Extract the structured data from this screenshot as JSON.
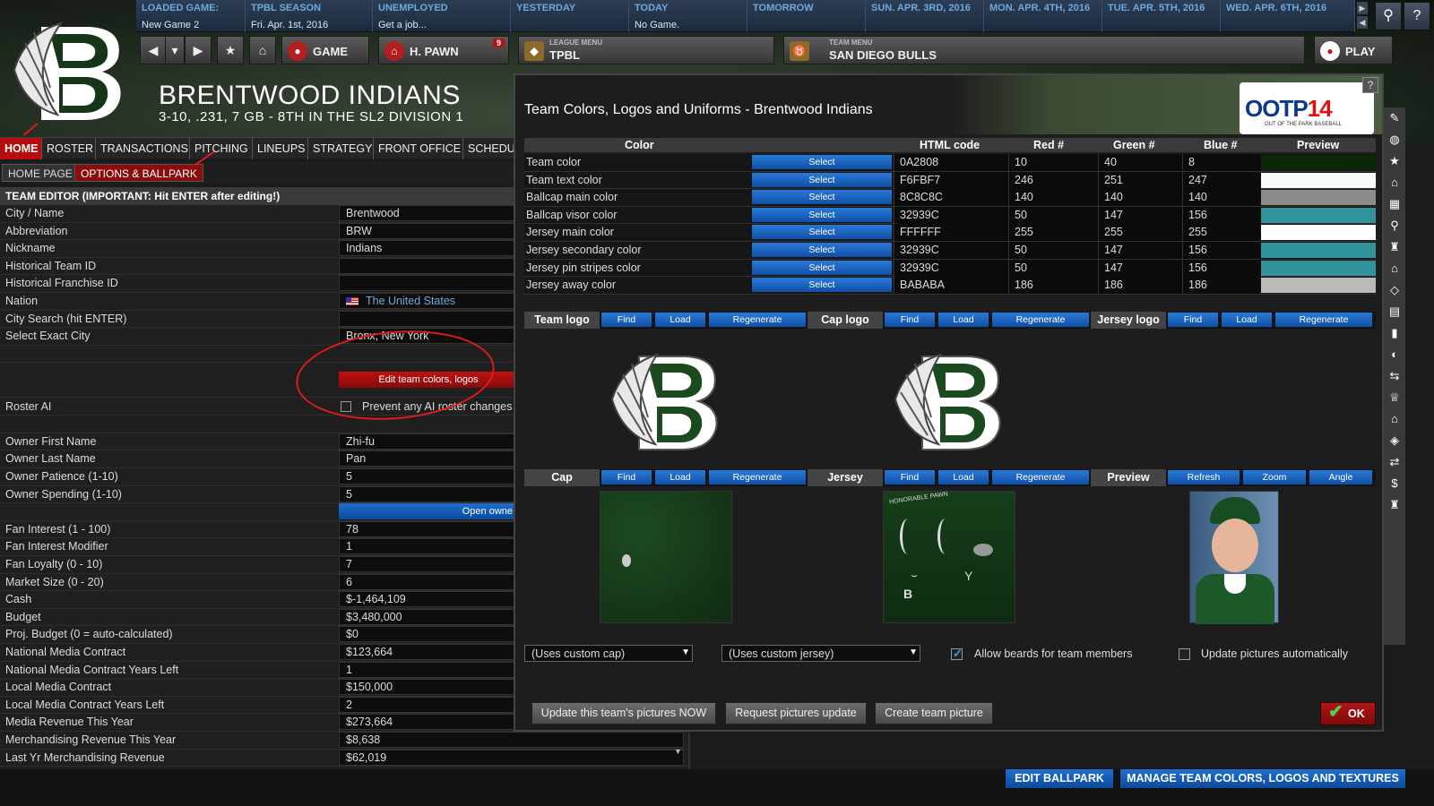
{
  "timeline": {
    "loaded_game_label": "LOADED GAME:",
    "loaded_game_value": "New Game 2",
    "season_label": "TPBL SEASON",
    "season_value": "Fri. Apr. 1st, 2016",
    "job_label": "UNEMPLOYED",
    "job_value": "Get a job...",
    "yesterday_label": "YESTERDAY",
    "today_label": "TODAY",
    "today_value": "No Game.",
    "tomorrow_label": "TOMORROW",
    "days": [
      "SUN. APR. 3RD, 2016",
      "MON. APR. 4TH, 2016",
      "TUE. APR. 5TH, 2016",
      "WED. APR. 6TH, 2016"
    ]
  },
  "nav": {
    "game_label": "GAME",
    "manager_label": "H. PAWN",
    "manager_badge": "9",
    "league_menu_small": "LEAGUE MENU",
    "league_menu_value": "TPBL",
    "team_menu_small": "TEAM MENU",
    "team_menu_value": "SAN DIEGO BULLS",
    "play_label": "PLAY"
  },
  "team": {
    "name": "BRENTWOOD INDIANS",
    "summary": "3-10, .231, 7 GB - 8TH IN THE SL2 DIVISION 1"
  },
  "tabs": [
    "HOME",
    "ROSTER",
    "TRANSACTIONS",
    "PITCHING",
    "LINEUPS",
    "STRATEGY",
    "FRONT OFFICE",
    "SCHEDULE"
  ],
  "subtabs": [
    "HOME PAGE",
    "OPTIONS & BALLPARK"
  ],
  "editor": {
    "header": "TEAM EDITOR (IMPORTANT: Hit ENTER after editing!)",
    "rows": [
      {
        "label": "City / Name",
        "value": "Brentwood"
      },
      {
        "label": "Abbreviation",
        "value": "BRW"
      },
      {
        "label": "Nickname",
        "value": "Indians"
      },
      {
        "label": "Historical Team ID",
        "value": ""
      },
      {
        "label": "Historical Franchise ID",
        "value": ""
      },
      {
        "label": "Nation",
        "value": "The United States"
      },
      {
        "label": "City Search (hit ENTER)",
        "value": ""
      },
      {
        "label": "Select Exact City",
        "value": "Bronx, New York"
      }
    ],
    "edit_colors_button": "Edit team colors, logos",
    "roster_ai_label": "Roster AI",
    "roster_ai_checkbox": "Prevent any AI roster changes",
    "owner_rows": [
      {
        "label": "Owner First Name",
        "value": "Zhi-fu"
      },
      {
        "label": "Owner Last Name",
        "value": "Pan"
      },
      {
        "label": "Owner Patience (1-10)",
        "value": "5"
      },
      {
        "label": "Owner Spending (1-10)",
        "value": "5"
      }
    ],
    "open_owner_button": "Open owne",
    "finance_rows": [
      {
        "label": "Fan Interest (1 - 100)",
        "value": "78"
      },
      {
        "label": "Fan Interest Modifier",
        "value": "1"
      },
      {
        "label": "Fan Loyalty (0 - 10)",
        "value": "7"
      },
      {
        "label": "Market Size (0 - 20)",
        "value": "6"
      },
      {
        "label": "Cash",
        "value": "$-1,464,109"
      },
      {
        "label": "Budget",
        "value": "$3,480,000"
      },
      {
        "label": "Proj. Budget (0 = auto-calculated)",
        "value": "$0"
      },
      {
        "label": "National Media Contract",
        "value": "$123,664"
      },
      {
        "label": "National Media Contract Years Left",
        "value": "1"
      },
      {
        "label": "Local Media Contract",
        "value": "$150,000"
      },
      {
        "label": "Local Media Contract Years Left",
        "value": "2"
      },
      {
        "label": "Media Revenue This Year",
        "value": "$273,664"
      },
      {
        "label": "Merchandising Revenue This Year",
        "value": "$8,638"
      },
      {
        "label": "Last Yr Merchandising Revenue",
        "value": "$62,019"
      }
    ]
  },
  "dialog": {
    "title": "Team Colors, Logos and Uniforms - Brentwood Indians",
    "help": "?",
    "brand": "OOTP",
    "brand_num": "14",
    "brand_sub": "OUT OF THE PARK BASEBALL",
    "table_headers": [
      "Color",
      "HTML code",
      "Red #",
      "Green #",
      "Blue #",
      "Preview"
    ],
    "select_label": "Select",
    "colors": [
      {
        "name": "Team color",
        "html": "0A2808",
        "r": "10",
        "g": "40",
        "b": "8",
        "hex": "#0A2808"
      },
      {
        "name": "Team text color",
        "html": "F6FBF7",
        "r": "246",
        "g": "251",
        "b": "247",
        "hex": "#F6FBF7"
      },
      {
        "name": "Ballcap main color",
        "html": "8C8C8C",
        "r": "140",
        "g": "140",
        "b": "140",
        "hex": "#8C8C8C"
      },
      {
        "name": "Ballcap visor color",
        "html": "32939C",
        "r": "50",
        "g": "147",
        "b": "156",
        "hex": "#32939C"
      },
      {
        "name": "Jersey main color",
        "html": "FFFFFF",
        "r": "255",
        "g": "255",
        "b": "255",
        "hex": "#FFFFFF"
      },
      {
        "name": "Jersey secondary color",
        "html": "32939C",
        "r": "50",
        "g": "147",
        "b": "156",
        "hex": "#32939C"
      },
      {
        "name": "Jersey pin stripes color",
        "html": "32939C",
        "r": "50",
        "g": "147",
        "b": "156",
        "hex": "#32939C"
      },
      {
        "name": "Jersey away color",
        "html": "BABABA",
        "r": "186",
        "g": "186",
        "b": "186",
        "hex": "#BABABA"
      }
    ],
    "team_logo_label": "Team logo",
    "cap_logo_label": "Cap logo",
    "jersey_logo_label": "Jersey logo",
    "find_label": "Find",
    "load_label": "Load",
    "regenerate_label": "Regenerate",
    "cap_label": "Cap",
    "jersey_label": "Jersey",
    "preview_label": "Preview",
    "refresh_label": "Refresh",
    "zoom_label": "Zoom",
    "angle_label": "Angle",
    "jersey_tex_text": "HONORABLE PAWN",
    "cap_select": "(Uses custom cap)",
    "jersey_select": "(Uses custom jersey)",
    "allow_beards": "Allow beards for team members",
    "update_auto": "Update pictures automatically",
    "update_now": "Update this team's pictures NOW",
    "request_update": "Request pictures update",
    "create_picture": "Create team picture",
    "ok": "OK"
  },
  "bottom": {
    "edit_ballpark": "EDIT BALLPARK",
    "manage_colors": "MANAGE TEAM COLORS, LOGOS AND TEXTURES"
  },
  "colors": {
    "accent_red": "#b30d0d",
    "accent_blue": "#1f6fcf",
    "team_green": "#0A2808"
  }
}
